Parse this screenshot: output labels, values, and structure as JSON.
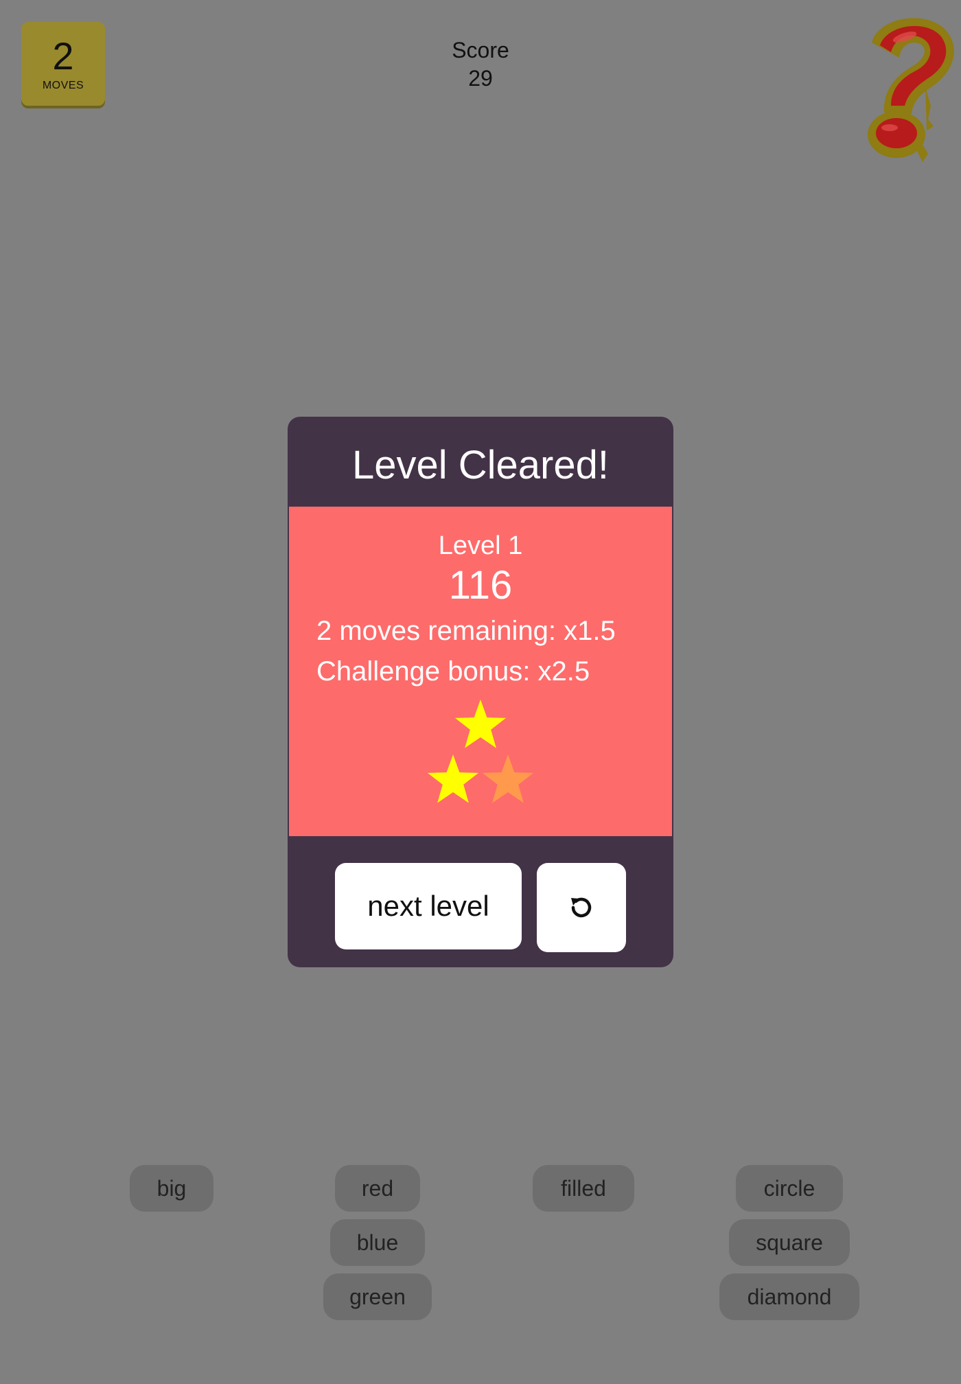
{
  "hud": {
    "moves_count": "2",
    "moves_label": "MOVES",
    "score_label": "Score",
    "score_value": "29",
    "help_icon": "question-mark-icon"
  },
  "modal": {
    "title": "Level Cleared!",
    "level_label": "Level 1",
    "level_score": "116",
    "moves_bonus": "2 moves remaining: x1.5",
    "challenge_bonus": "Challenge bonus: x2.5",
    "stars_earned": 2,
    "stars_total": 3,
    "next_label": "next level",
    "restart_icon": "restart-icon"
  },
  "chips": {
    "size": [
      "big"
    ],
    "color": [
      "red",
      "blue",
      "green"
    ],
    "fill": [
      "filled"
    ],
    "shape": [
      "circle",
      "square",
      "diamond"
    ]
  },
  "colors": {
    "background": "#808080",
    "modal_bg": "#433347",
    "panel_bg": "#fe6b6b",
    "star_earned": "#ffff00",
    "star_empty": "#ff9a4d",
    "moves_badge": "#998a2e",
    "chip_bg": "#6e6e6e"
  }
}
